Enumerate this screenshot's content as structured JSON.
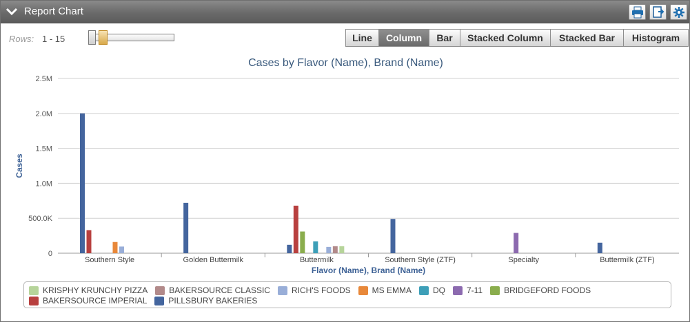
{
  "window": {
    "title": "Report Chart",
    "toolbar_icons": [
      "print-icon",
      "export-icon",
      "gear-icon"
    ]
  },
  "rows": {
    "label": "Rows:",
    "value": "1 - 15"
  },
  "chart_types": [
    {
      "label": "Line",
      "active": false
    },
    {
      "label": "Column",
      "active": true
    },
    {
      "label": "Bar",
      "active": false
    },
    {
      "label": "Stacked Column",
      "active": false
    },
    {
      "label": "Stacked Bar",
      "active": false
    },
    {
      "label": "Histogram",
      "active": false
    }
  ],
  "chart_data": {
    "type": "bar",
    "title": "Cases by Flavor (Name), Brand (Name)",
    "xlabel": "Flavor (Name), Brand (Name)",
    "ylabel": "Cases",
    "ylim": [
      0,
      2500000
    ],
    "yticks": [
      0,
      500000,
      1000000,
      1500000,
      2000000,
      2500000
    ],
    "ytick_labels": [
      "0",
      "500.0K",
      "1.0M",
      "1.5M",
      "2.0M",
      "2.5M"
    ],
    "grid": true,
    "legend_position": "bottom",
    "categories": [
      "Southern Style",
      "Golden Buttermilk",
      "Buttermilk",
      "Southern Style (ZTF)",
      "Specialty",
      "Buttermilk (ZTF)"
    ],
    "series": [
      {
        "name": "KRISPHY KRUNCHY PIZZA",
        "color": "#b6d49a",
        "values": [
          null,
          null,
          100000,
          null,
          null,
          null
        ]
      },
      {
        "name": "BAKERSOURCE CLASSIC",
        "color": "#b28a8a",
        "values": [
          null,
          null,
          100000,
          null,
          null,
          null
        ]
      },
      {
        "name": "RICH'S FOODS",
        "color": "#99aed8",
        "values": [
          95000,
          null,
          90000,
          null,
          null,
          null
        ]
      },
      {
        "name": "MS EMMA",
        "color": "#e8883a",
        "values": [
          160000,
          null,
          null,
          null,
          null,
          null
        ]
      },
      {
        "name": "DQ",
        "color": "#3d9fb8",
        "values": [
          null,
          null,
          170000,
          null,
          null,
          null
        ]
      },
      {
        "name": "7-11",
        "color": "#8c6aaf",
        "values": [
          null,
          null,
          null,
          null,
          290000,
          null
        ]
      },
      {
        "name": "BRIDGEFORD FOODS",
        "color": "#8aad4d",
        "values": [
          null,
          null,
          310000,
          null,
          null,
          null
        ]
      },
      {
        "name": "BAKERSOURCE IMPERIAL",
        "color": "#b8403f",
        "values": [
          330000,
          null,
          680000,
          null,
          null,
          null
        ]
      },
      {
        "name": "PILLSBURY BAKERIES",
        "color": "#44659e",
        "values": [
          2000000,
          720000,
          120000,
          490000,
          null,
          150000
        ]
      }
    ]
  }
}
